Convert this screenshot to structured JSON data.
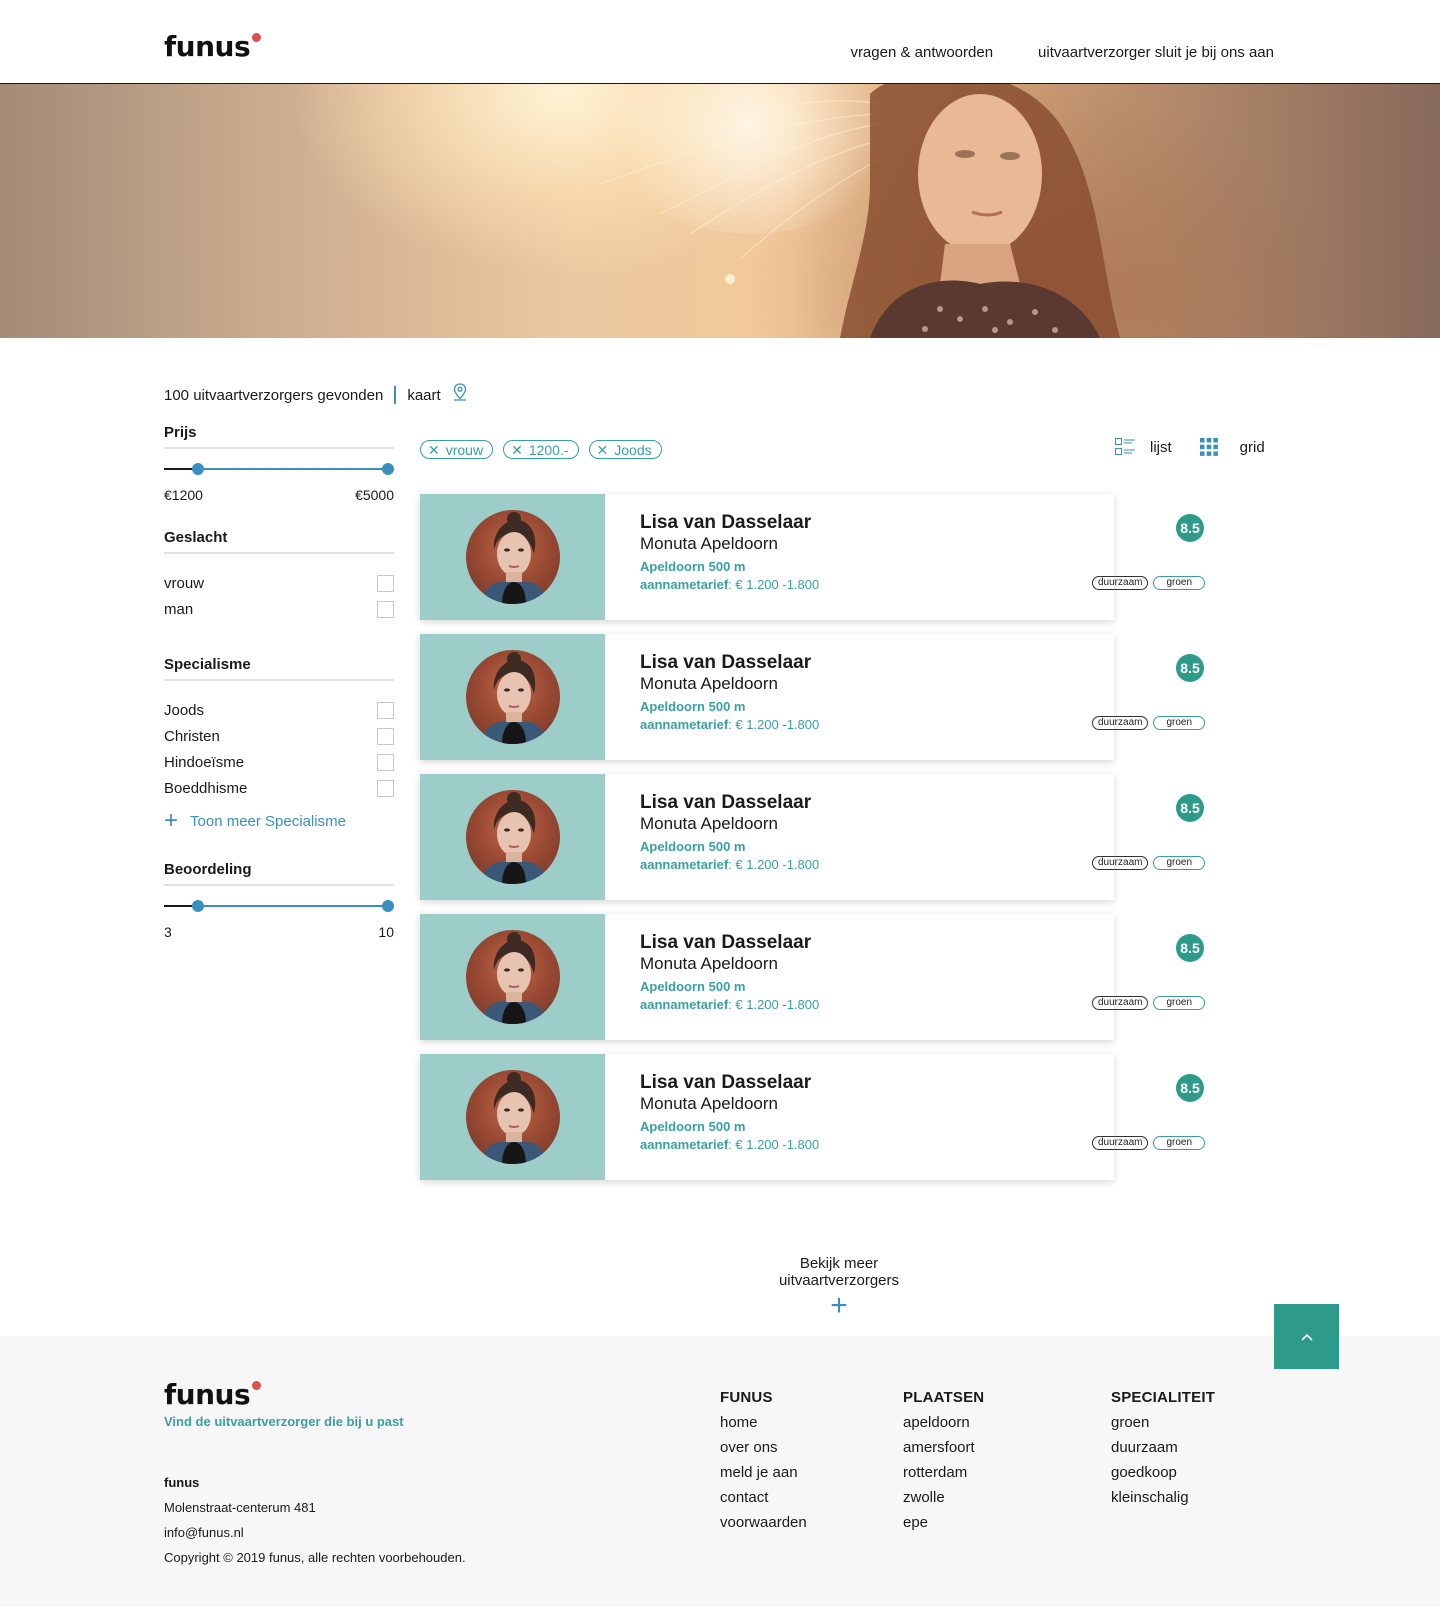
{
  "header": {
    "logo": "funus",
    "nav": [
      "vragen & antwoorden",
      "uitvaartverzorger sluit je bij ons aan"
    ]
  },
  "results": {
    "count_text": "100 uitvaartverzorgers gevonden",
    "map_label": "kaart"
  },
  "filters": {
    "price": {
      "title": "Prijs",
      "min_label": "€1200",
      "max_label": "€5000",
      "low": 1200,
      "high": 5000
    },
    "gender": {
      "title": "Geslacht",
      "options": [
        "vrouw",
        "man"
      ]
    },
    "specialism": {
      "title": "Specialisme",
      "options": [
        "Joods",
        "Christen",
        "Hindoeïsme",
        "Boeddhisme"
      ],
      "show_more": "Toon meer Specialisme"
    },
    "rating": {
      "title": "Beoordeling",
      "min_label": "3",
      "max_label": "10",
      "low": 3,
      "high": 10
    }
  },
  "active_filters": [
    "vrouw",
    "1200.-",
    "Joods"
  ],
  "view": {
    "list_label": "lijst",
    "grid_label": "grid"
  },
  "cards": [
    {
      "name": "Lisa van Dasselaar",
      "company": "Monuta Apeldoorn",
      "distance": "Apeldoorn 500 m",
      "rate_label": "aannametarief",
      "rate_value": ": € 1.200 -1.800",
      "score": "8.5",
      "tags": [
        "duurzaam",
        "groen"
      ]
    },
    {
      "name": "Lisa van Dasselaar",
      "company": "Monuta Apeldoorn",
      "distance": "Apeldoorn 500 m",
      "rate_label": "aannametarief",
      "rate_value": ": € 1.200 -1.800",
      "score": "8.5",
      "tags": [
        "duurzaam",
        "groen"
      ]
    },
    {
      "name": "Lisa van Dasselaar",
      "company": "Monuta Apeldoorn",
      "distance": "Apeldoorn 500 m",
      "rate_label": "aannametarief",
      "rate_value": ": € 1.200 -1.800",
      "score": "8.5",
      "tags": [
        "duurzaam",
        "groen"
      ]
    },
    {
      "name": "Lisa van Dasselaar",
      "company": "Monuta Apeldoorn",
      "distance": "Apeldoorn 500 m",
      "rate_label": "aannametarief",
      "rate_value": ": € 1.200 -1.800",
      "score": "8.5",
      "tags": [
        "duurzaam",
        "groen"
      ]
    },
    {
      "name": "Lisa van Dasselaar",
      "company": "Monuta Apeldoorn",
      "distance": "Apeldoorn 500 m",
      "rate_label": "aannametarief",
      "rate_value": ": € 1.200 -1.800",
      "score": "8.5",
      "tags": [
        "duurzaam",
        "groen"
      ]
    }
  ],
  "load_more": "Bekijk meer uitvaartverzorgers",
  "footer": {
    "logo": "funus",
    "tagline": "Vind de uitvaartverzorger die bij u past",
    "company_name": "funus",
    "address": "Molenstraat-centerum 481",
    "email": "info@funus.nl",
    "copyright": "Copyright © 2019 funus, alle rechten voorbehouden.",
    "columns": [
      {
        "title": "FUNUS",
        "links": [
          "home",
          "over ons",
          "meld je aan",
          "contact",
          "voorwaarden"
        ]
      },
      {
        "title": "PLAATSEN",
        "links": [
          "apeldoorn",
          "amersfoort",
          "rotterdam",
          "zwolle",
          "epe"
        ]
      },
      {
        "title": "SPECIALITEIT",
        "links": [
          "groen",
          "duurzaam",
          "goedkoop",
          "kleinschalig"
        ]
      }
    ]
  },
  "colors": {
    "accent_teal": "#2e9b8a",
    "accent_blue": "#3a8fbf",
    "card_photo_bg": "#9ccdc8",
    "logo_dot": "#d9534f"
  },
  "icons": [
    "map-pin-icon",
    "list-view-icon",
    "grid-view-icon",
    "close-icon",
    "plus-icon",
    "chevron-up-icon"
  ]
}
